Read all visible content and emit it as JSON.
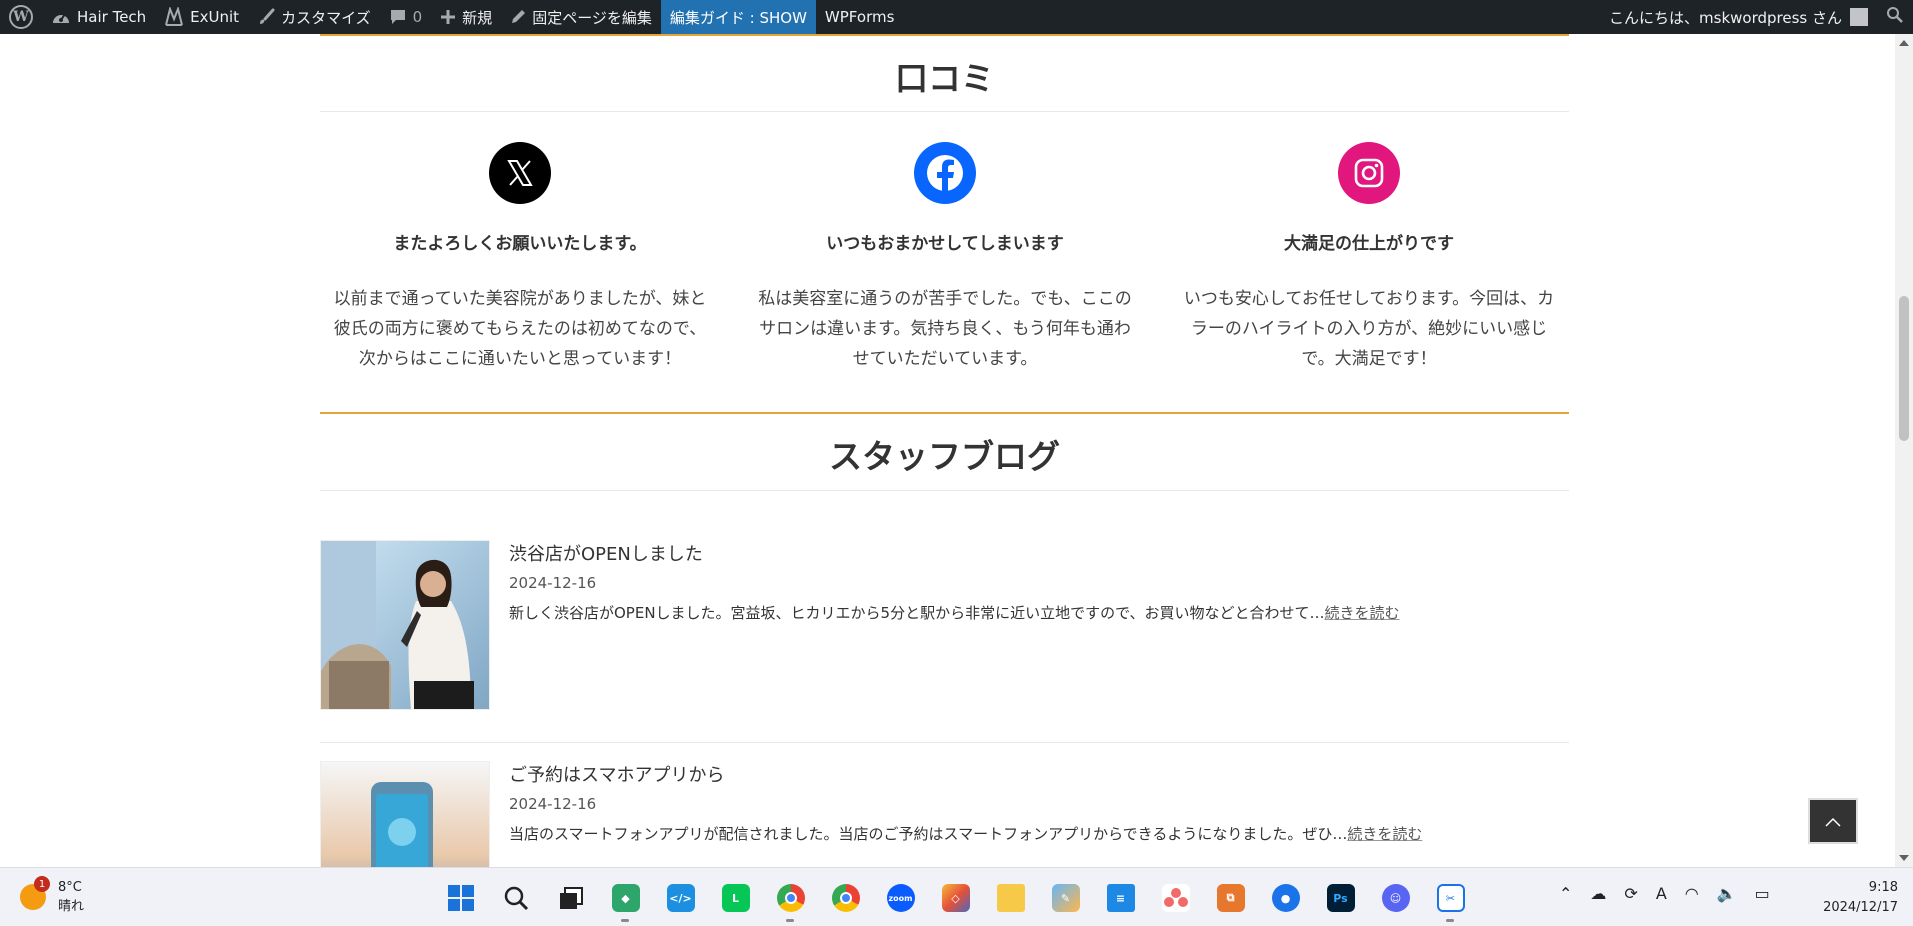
{
  "adminbar": {
    "site_name": "Hair Tech",
    "exunit": "ExUnit",
    "customize": "カスタマイズ",
    "comments_count": "0",
    "new": "新規",
    "edit_page": "固定ページを編集",
    "edit_guide": "編集ガイド : SHOW",
    "wpforms": "WPForms",
    "greeting": "こんにちは、mskwordpress さん"
  },
  "reviews_section": {
    "title": "口コミ",
    "items": [
      {
        "icon": "x-twitter-icon",
        "color": "#000000",
        "title": "またよろしくお願いいたします。",
        "lines": [
          "以前まで通っていた美容院がありましたが、妹と",
          "彼氏の両方に褒めてもらえたのは初めてなので、",
          "次からはここに通いたいと思っています！"
        ]
      },
      {
        "icon": "facebook-icon",
        "color": "#0866ff",
        "title": "いつもおまかせしてしまいます",
        "lines": [
          "私は美容室に通うのが苦手でした。でも、ここの",
          "サロンは違います。気持ち良く、もう何年も通わ",
          "せていただいています。"
        ]
      },
      {
        "icon": "instagram-icon",
        "color": "#e1177e",
        "title": "大満足の仕上がりです",
        "lines": [
          "いつも安心してお任せしております。今回は、カ",
          "ラーのハイライトの入り方が、絶妙にいい感じ",
          "で。大満足です！"
        ]
      }
    ]
  },
  "blog_section": {
    "title": "スタッフブログ",
    "posts": [
      {
        "title": "渋谷店がOPENしました",
        "date": "2024-12-16",
        "excerpt": "新しく渋谷店がOPENしました。宮益坂、ヒカリエから5分と駅から非常に近い立地ですので、お買い物などと合わせて…",
        "more": "続きを読む"
      },
      {
        "title": "ご予約はスマホアプリから",
        "date": "2024-12-16",
        "excerpt": "当店のスマートフォンアプリが配信されました。当店のご予約はスマートフォンアプリからできるようになりました。ぜひ…",
        "more": "続きを読む"
      }
    ]
  },
  "taskbar": {
    "weather_badge": "1",
    "temperature": "8°C",
    "condition": "晴れ",
    "time": "9:18",
    "date": "2024/12/17",
    "ime": "A"
  }
}
